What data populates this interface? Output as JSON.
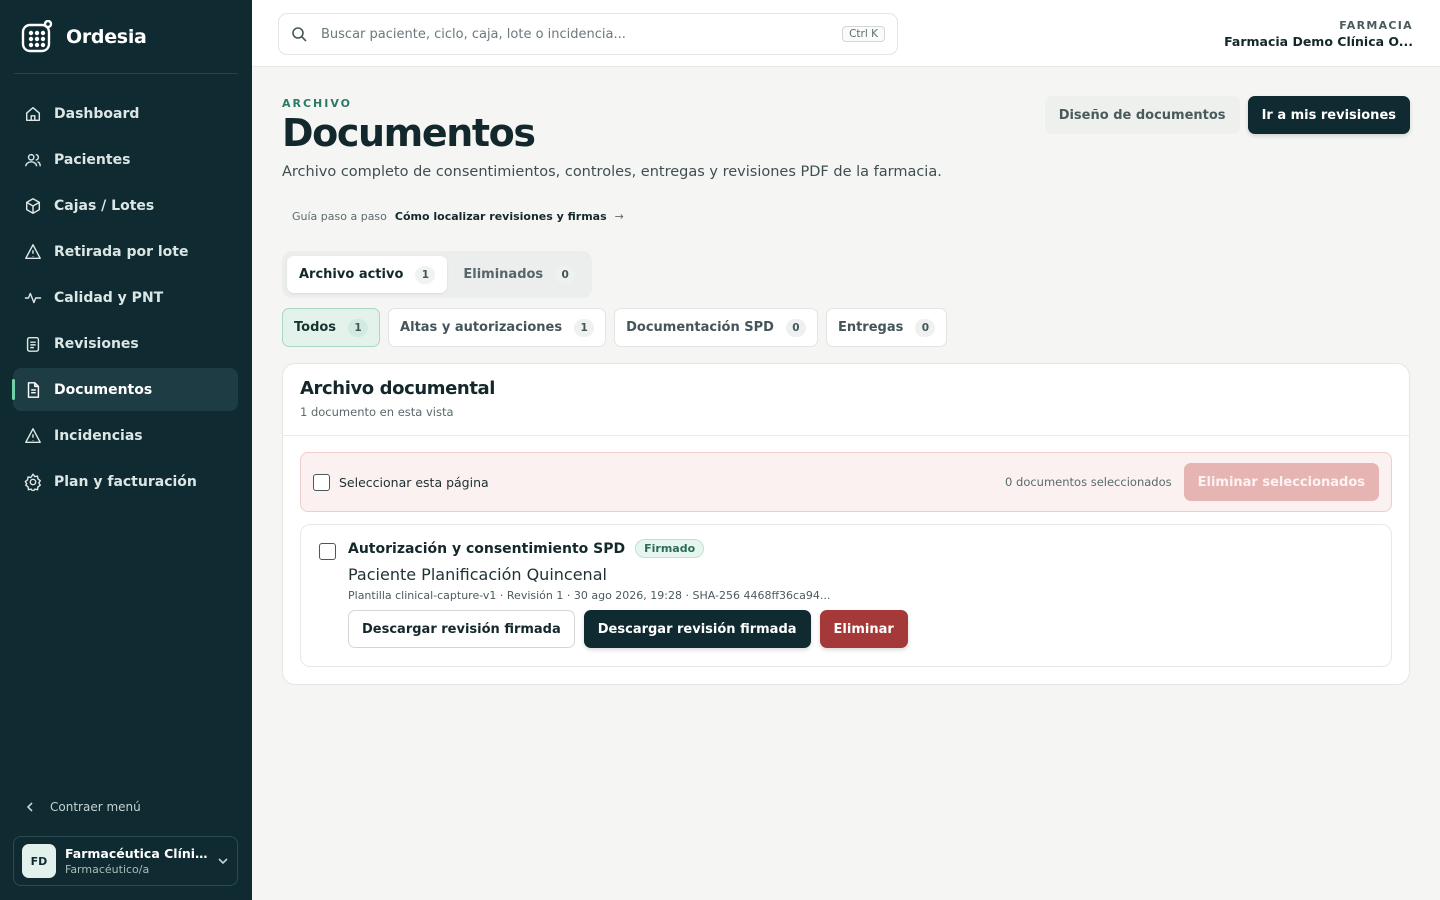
{
  "app": {
    "name": "Ordesia",
    "logo_icon": "grid-logo-icon"
  },
  "sidebar": {
    "items": [
      {
        "label": "Dashboard",
        "icon": "home-icon"
      },
      {
        "label": "Pacientes",
        "icon": "users-icon"
      },
      {
        "label": "Cajas / Lotes",
        "icon": "box-icon"
      },
      {
        "label": "Retirada por lote",
        "icon": "warning-icon"
      },
      {
        "label": "Calidad y PNT",
        "icon": "pulse-icon"
      },
      {
        "label": "Revisiones",
        "icon": "clipboard-icon"
      },
      {
        "label": "Documentos",
        "icon": "document-icon",
        "active": true
      },
      {
        "label": "Incidencias",
        "icon": "warning-icon"
      },
      {
        "label": "Plan y facturación",
        "icon": "settings-icon"
      }
    ],
    "collapse_label": "Contraer menú",
    "user": {
      "initials": "FD",
      "name": "Farmacéutica Clínica Demo",
      "role": "Farmacéutico/a"
    }
  },
  "topbar": {
    "search_placeholder": "Buscar paciente, ciclo, caja, lote o incidencia...",
    "shortcut": "Ctrl K",
    "tenant_label": "FARMACIA",
    "tenant_name": "Farmacia Demo Clínica O..."
  },
  "page": {
    "eyebrow": "ARCHIVO",
    "title": "Documentos",
    "description": "Archivo completo de consentimientos, controles, entregas y revisiones PDF de la farmacia.",
    "actions": {
      "design": "Diseño de documentos",
      "my_reviews": "Ir a mis revisiones"
    },
    "guide": {
      "prefix": "Guía paso a paso",
      "link": "Cómo localizar revisiones y firmas",
      "arrow": "→"
    }
  },
  "archive_tabs": [
    {
      "label": "Archivo activo",
      "count": "1",
      "active": true
    },
    {
      "label": "Eliminados",
      "count": "0",
      "active": false
    }
  ],
  "filters": [
    {
      "label": "Todos",
      "count": "1",
      "active": true
    },
    {
      "label": "Altas y autorizaciones",
      "count": "1",
      "active": false
    },
    {
      "label": "Documentación SPD",
      "count": "0",
      "active": false
    },
    {
      "label": "Entregas",
      "count": "0",
      "active": false
    }
  ],
  "card": {
    "title": "Archivo documental",
    "subtitle": "1 documento en esta vista",
    "bulk": {
      "select_label": "Seleccionar esta página",
      "selected_count": "0 documentos seleccionados",
      "delete_label": "Eliminar seleccionados"
    },
    "documents": [
      {
        "title": "Autorización y consentimiento SPD",
        "status": "Firmado",
        "patient": "Paciente Planificación Quincenal",
        "meta": "Plantilla clinical-capture-v1 · Revisión 1 · 30 ago 2026, 19:28 · SHA-256 4468ff36ca94...",
        "actions": {
          "download_outline": "Descargar revisión firmada",
          "download_primary": "Descargar revisión firmada",
          "delete": "Eliminar"
        }
      }
    ]
  },
  "colors": {
    "sidebar_bg": "#0f2a30",
    "accent": "#2b7a66",
    "danger": "#a53838",
    "page_bg": "#f5f6f4"
  }
}
